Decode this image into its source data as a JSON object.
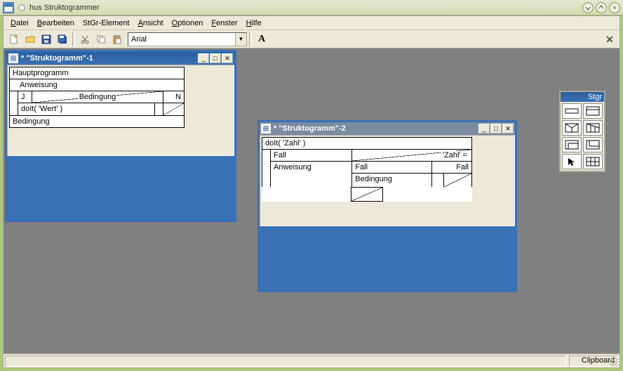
{
  "app": {
    "title": "hus Struktogrammer"
  },
  "menubar": {
    "items": [
      {
        "label": "Datei",
        "hot": "D"
      },
      {
        "label": "Bearbeiten",
        "hot": "B"
      },
      {
        "label": "StGr-Element",
        "hot": ""
      },
      {
        "label": "Ansicht",
        "hot": "A"
      },
      {
        "label": "Optionen",
        "hot": "O"
      },
      {
        "label": "Fenster",
        "hot": "F"
      },
      {
        "label": "Hilfe",
        "hot": "H"
      }
    ]
  },
  "toolbar": {
    "font_value": "Arial",
    "font_style_button": "A"
  },
  "child1": {
    "title": "* \"Struktogramm\"-1",
    "c_hauptprogramm": "Hauptprogramm",
    "c_anweisung": "Anweisung",
    "c_bedingung_top": "Bedingung",
    "c_j": "J",
    "c_n": "N",
    "c_doit": "doIt( 'Wert' )",
    "c_bedingung_bottom": "Bedingung"
  },
  "child2": {
    "title": "* \"Struktogramm\"-2",
    "c_doit": "doIt( 'Zahl' )",
    "c_zahl_eq": "'Zahl' =",
    "c_fall1": "Fall",
    "c_fall2": "Fall",
    "c_fall3": "Fall",
    "c_anweisung": "Anweisung",
    "c_bedingung": "Bedingung"
  },
  "toolbox": {
    "title": "Stgr"
  },
  "statusbar": {
    "main": "",
    "right": "Clipboard"
  }
}
